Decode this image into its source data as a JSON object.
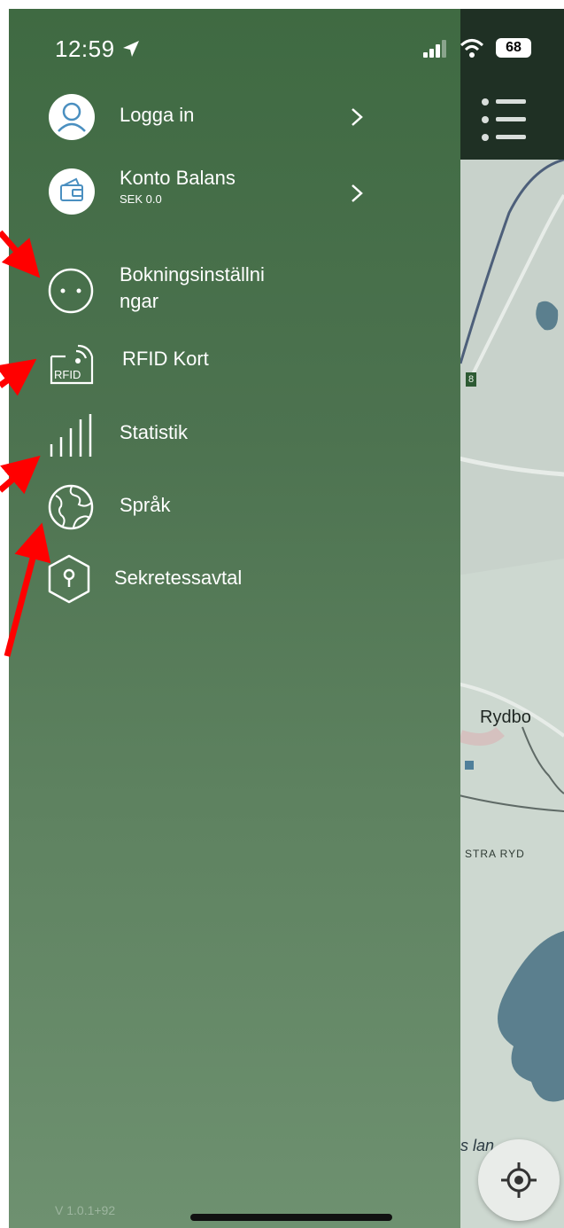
{
  "status_bar": {
    "time": "12:59",
    "battery": "68"
  },
  "menu": {
    "items": [
      {
        "label": "Logga in",
        "icon": "user-icon"
      },
      {
        "label": "Konto Balans",
        "sublabel": "SEK 0.0",
        "icon": "wallet-icon"
      },
      {
        "label": "Bokningsinställni",
        "label2": "ngar",
        "icon": "socket-icon"
      },
      {
        "label": "RFID Kort",
        "icon_text": "RFID",
        "icon": "rfid-card-icon"
      },
      {
        "label": "Statistik",
        "icon": "bars-icon"
      },
      {
        "label": "Språk",
        "icon": "globe-icon"
      },
      {
        "label": "Sekretessavtal",
        "icon": "shield-keyhole-icon"
      }
    ]
  },
  "version": "V 1.0.1+92",
  "map": {
    "town_label": "Rydbo",
    "area_label": "STRA RYD",
    "road_label": "8",
    "water_label": "ges  lan"
  },
  "colors": {
    "drawer_top": "#3f6a42",
    "drawer_bottom": "#6e9170",
    "annotation_arrow": "#ff0000"
  }
}
